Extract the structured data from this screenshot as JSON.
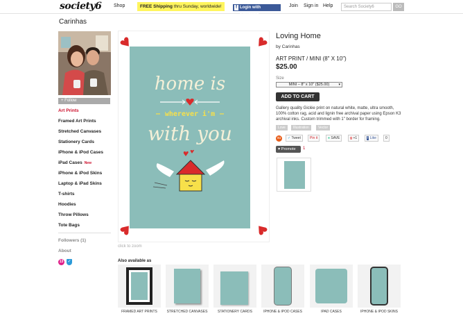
{
  "header": {
    "logo": "society6",
    "nav": [
      "Shop",
      "Join",
      "Sign in",
      "Help"
    ],
    "shipping_bold": "FREE Shipping",
    "shipping_rest": " thru Sunday, worldwide!",
    "facebook": "Login with Facebook",
    "search_placeholder": "Search Society6",
    "go": "GO"
  },
  "sidebar": {
    "artist": "Carinhas",
    "follow": "+ Follow",
    "items": [
      {
        "label": "Art Prints",
        "active": true
      },
      {
        "label": "Framed Art Prints"
      },
      {
        "label": "Stretched Canvases"
      },
      {
        "label": "Stationery Cards"
      },
      {
        "label": "iPhone & iPod Cases"
      },
      {
        "label": "iPad Cases",
        "badge": "New"
      },
      {
        "label": "iPhone & iPod Skins"
      },
      {
        "label": "Laptop & iPad Skins"
      },
      {
        "label": "T-shirts"
      },
      {
        "label": "Hoodies"
      },
      {
        "label": "Throw Pillows"
      },
      {
        "label": "Tote Bags"
      }
    ],
    "followers": "Followers (1)",
    "about": "About",
    "badge_num": "13"
  },
  "artwork": {
    "line1": "home is",
    "line2": "wherever i'm",
    "line3": "with you",
    "colors": {
      "bg": "#8bbdb9",
      "heart": "#d92b2b",
      "yellow": "#f7e04a",
      "cream": "#f4f0d8"
    }
  },
  "zoom_hint": "click to zoom",
  "product": {
    "title": "Loving Home",
    "by": "by Carinhas",
    "type": "ART PRINT / MINI (8\" X 10\")",
    "price": "$25.00",
    "size_label": "Size",
    "size_value": "MINI – 8\" x 10\" ($25.00)",
    "cart": "ADD TO CART",
    "description": "Gallery quality Giclée print on natural white, matte, ultra smooth, 100% cotton rag, acid and lignin free archival paper using Epson K3 archival inks. Custom trimmed with 1\" border for framing.",
    "tags": [
      "Love",
      "Illustration",
      "Vector"
    ],
    "share": {
      "tweet": "Tweet",
      "pin": "Pin it",
      "save": "SAVE",
      "gplus": "+1",
      "like": "Like",
      "like_count": "0"
    },
    "promote": "Promote",
    "promote_count": "1"
  },
  "also": {
    "heading": "Also available as",
    "items": [
      "FRAMED ART PRINTS",
      "STRETCHED CANVASES",
      "STATIONERY CARDS",
      "IPHONE & IPOD CASES",
      "IPAD CASES",
      "IPHONE & IPOD SKINS"
    ]
  }
}
